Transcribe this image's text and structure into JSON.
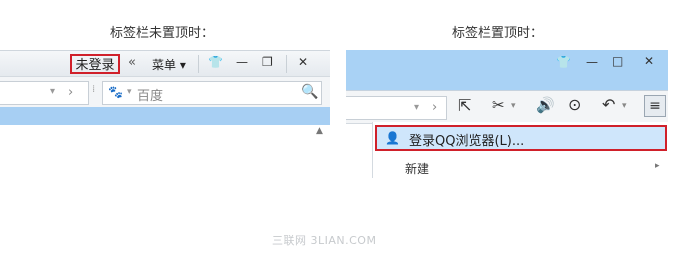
{
  "captions": {
    "left": "标签栏未置顶时：",
    "right": "标签栏置顶时："
  },
  "left_panel": {
    "unlogged_label": "未登录",
    "double_left": "«",
    "menu_label": "菜单",
    "search_placeholder": "百度"
  },
  "right_panel": {
    "login_item_label": "登录QQ浏览器(L)...",
    "new_item_label": "新建"
  },
  "watermark": "三联网 3LIAN.COM"
}
